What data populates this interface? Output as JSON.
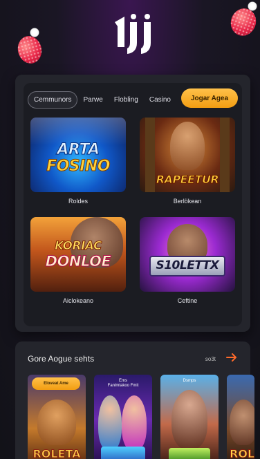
{
  "brand": {
    "logo_text": "1jj"
  },
  "nav": {
    "tabs": [
      {
        "label": "Cemmunors",
        "active": true
      },
      {
        "label": "Parwe",
        "active": false
      },
      {
        "label": "Flobling",
        "active": false
      },
      {
        "label": "Casino",
        "active": false
      }
    ],
    "cta_label": "Jogar Agea"
  },
  "games": [
    {
      "thumb_title_1": "ARTA",
      "thumb_title_2": "FOSINO",
      "label": "Roldes"
    },
    {
      "thumb_title_1": "RAPEETUR",
      "thumb_title_2": "",
      "label": "Berlökean"
    },
    {
      "thumb_title_1": "KORIAC",
      "thumb_title_2": "DONLOE",
      "label": "Aiclokeano"
    },
    {
      "thumb_title_1": "S10LETTX",
      "thumb_title_2": "",
      "label": "Ceftine"
    }
  ],
  "section2": {
    "title": "Gore Aogue sehts",
    "more_label": "so3t",
    "cards": [
      {
        "tag": "Eloveat Ame",
        "top": "",
        "name": "ROLETA"
      },
      {
        "tag": "",
        "top": "Ems\nFanlmtakoo Fmit",
        "name": ""
      },
      {
        "tag": "",
        "top": "Dsmps",
        "name": ""
      },
      {
        "tag": "",
        "top": "",
        "name": "ROLE"
      }
    ]
  },
  "colors": {
    "accent": "#f5a623",
    "panel": "#24252c",
    "arrow": "#ff6a2a"
  }
}
